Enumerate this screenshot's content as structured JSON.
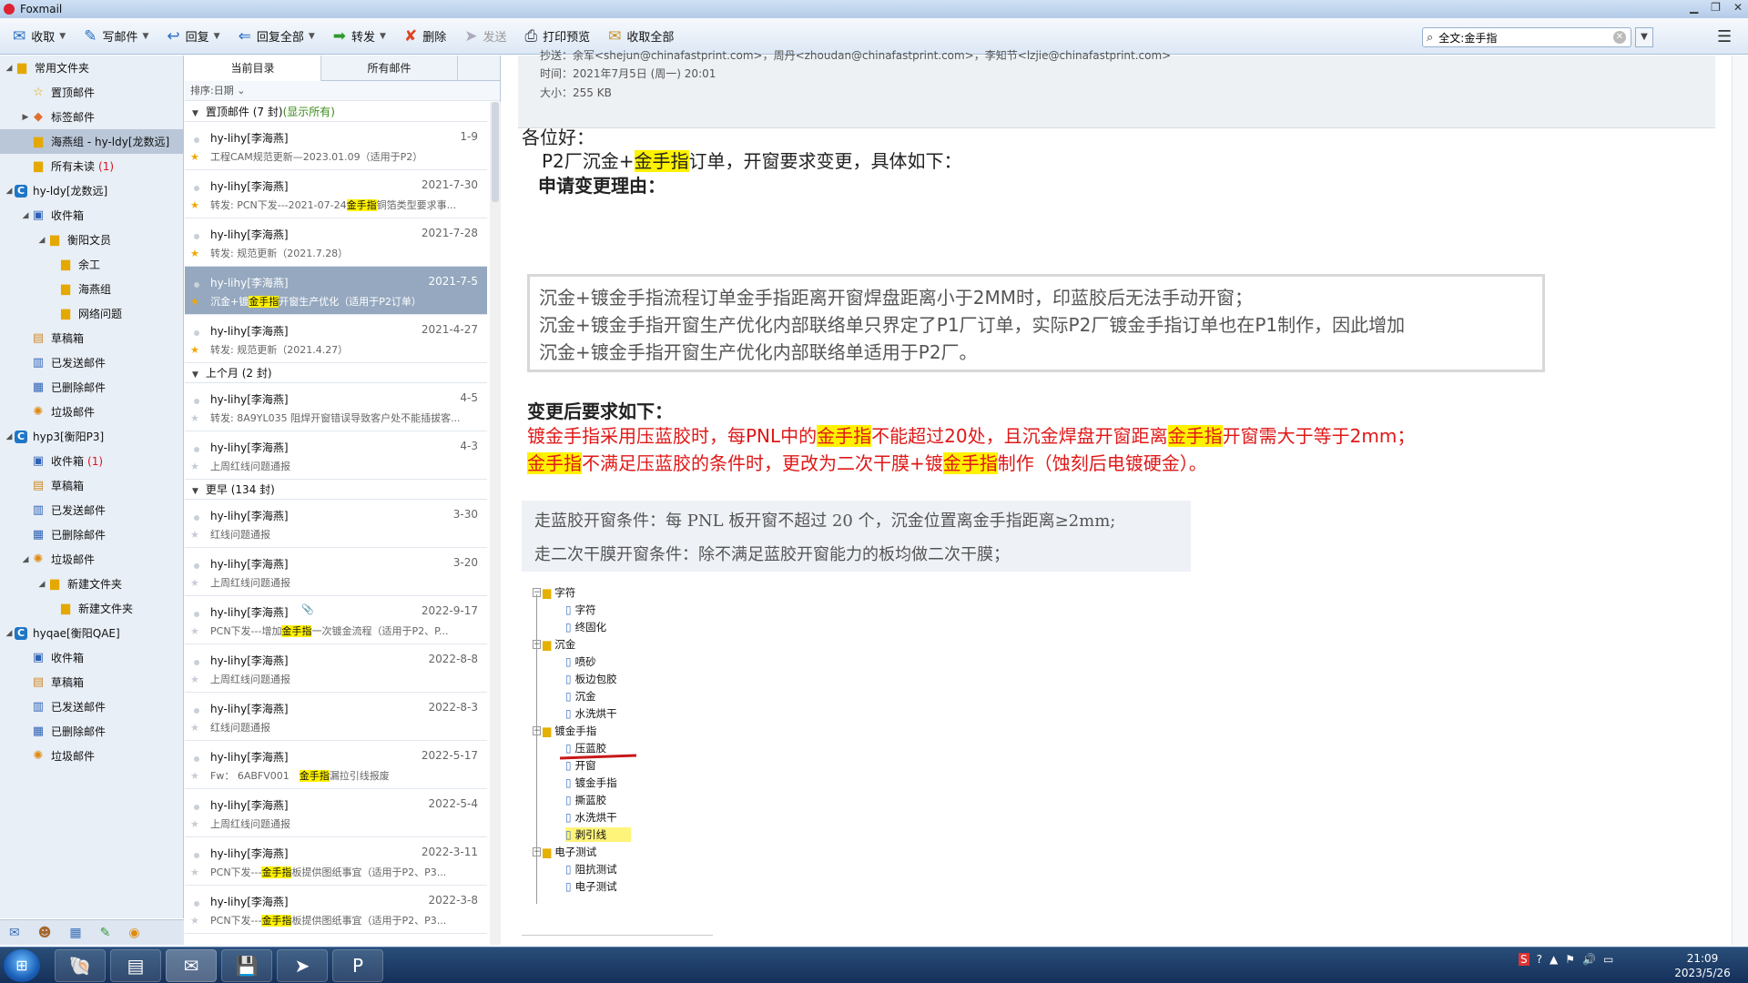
{
  "window": {
    "title": "Foxmail"
  },
  "toolbar": {
    "receive": "收取",
    "compose": "写邮件",
    "reply": "回复",
    "reply_all": "回复全部",
    "forward": "转发",
    "delete": "删除",
    "send": "发送",
    "print_preview": "打印预览",
    "receive_all": "收取全部"
  },
  "search": {
    "value": "全文:金手指"
  },
  "folders": {
    "common": "常用文件夹",
    "pinned": "置顶邮件",
    "tagged": "标签邮件",
    "haiyan": "海燕组 - hy-ldy[龙数远]",
    "unread": "所有未读",
    "unread_count": "(1)",
    "acct1": "hy-ldy[龙数远]",
    "inbox": "收件箱",
    "hengyang": "衡阳文员",
    "yu": "余工",
    "haiyan_group": "海燕组",
    "network": "网络问题",
    "drafts": "草稿箱",
    "sent": "已发送邮件",
    "deleted": "已删除邮件",
    "junk": "垃圾邮件",
    "acct2": "hyp3[衡阳P3]",
    "inbox_count": "(1)",
    "new_folder": "新建文件夹",
    "acct3": "hyqae[衡阳QAE]"
  },
  "maillist": {
    "tab_current": "当前目录",
    "tab_all": "所有邮件",
    "sort": "排序:日期",
    "group_pinned": "置顶邮件 (7 封)",
    "group_pinned_show": "(显示所有)",
    "group_lastmonth": "上个月 (2 封)",
    "group_earlier": "更早 (134 封)",
    "pinned": [
      {
        "from": "hy-lihy[李海燕]",
        "date": "1-9",
        "pre": "工程CAM规范更新—2023.01.09（适用于P2）",
        "hl": "",
        "post": ""
      },
      {
        "from": "hy-lihy[李海燕]",
        "date": "2021-7-30",
        "pre": "转发: PCN下发---2021-07-24",
        "hl": "金手指",
        "post": "铜箔类型要求事..."
      },
      {
        "from": "hy-lihy[李海燕]",
        "date": "2021-7-28",
        "pre": "转发: 规范更新（2021.7.28）",
        "hl": "",
        "post": ""
      },
      {
        "from": "hy-lihy[李海燕]",
        "date": "2021-7-5",
        "pre": "沉金+镀",
        "hl": "金手指",
        "post": "开窗生产优化（适用于P2订单）"
      },
      {
        "from": "hy-lihy[李海燕]",
        "date": "2021-4-27",
        "pre": "转发: 规范更新（2021.4.27）",
        "hl": "",
        "post": ""
      }
    ],
    "lastmonth": [
      {
        "from": "hy-lihy[李海燕]",
        "date": "4-5",
        "pre": "转发: 8A9YL035 阻焊开窗错误导致客户处不能插拔客...",
        "hl": "",
        "post": ""
      },
      {
        "from": "hy-lihy[李海燕]",
        "date": "4-3",
        "pre": "上周红线问题通报",
        "hl": "",
        "post": ""
      }
    ],
    "earlier": [
      {
        "from": "hy-lihy[李海燕]",
        "date": "3-30",
        "pre": "红线问题通报",
        "hl": "",
        "post": ""
      },
      {
        "from": "hy-lihy[李海燕]",
        "date": "3-20",
        "pre": "上周红线问题通报",
        "hl": "",
        "post": ""
      },
      {
        "from": "hy-lihy[李海燕]",
        "date": "2022-9-17",
        "pre": "PCN下发---增加",
        "hl": "金手指",
        "post": "一次镀金流程（适用于P2、P..."
      },
      {
        "from": "hy-lihy[李海燕]",
        "date": "2022-8-8",
        "pre": "上周红线问题通报",
        "hl": "",
        "post": ""
      },
      {
        "from": "hy-lihy[李海燕]",
        "date": "2022-8-3",
        "pre": "红线问题通报",
        "hl": "",
        "post": ""
      },
      {
        "from": "hy-lihy[李海燕]",
        "date": "2022-5-17",
        "pre": "Fw： 6ABFV001　",
        "hl": "金手指",
        "post": "漏拉引线报废"
      },
      {
        "from": "hy-lihy[李海燕]",
        "date": "2022-5-4",
        "pre": "上周红线问题通报",
        "hl": "",
        "post": ""
      },
      {
        "from": "hy-lihy[李海燕]",
        "date": "2022-3-11",
        "pre": "PCN下发---",
        "hl": "金手指",
        "post": "板提供图纸事宜（适用于P2、P3..."
      },
      {
        "from": "hy-lihy[李海燕]",
        "date": "2022-3-8",
        "pre": "PCN下发---",
        "hl": "金手指",
        "post": "板提供图纸事宜（适用于P2、P3..."
      }
    ]
  },
  "email": {
    "cc": "抄送：余军<shejun@chinafastprint.com>，周丹<zhoudan@chinafastprint.com>，李知节<lzjie@chinafastprint.com>",
    "time": "时间：2021年7月5日 (周一) 20:01",
    "size": "大小：255 KB",
    "greeting": "各位好：",
    "intro_a": "P2厂沉金+",
    "kw": "金手指",
    "intro_b": "订单，开窗要求变更，具体如下：",
    "reason_title": "申请变更理由：",
    "reason_lines": [
      "沉金+镀金手指流程订单金手指距离开窗焊盘距离小于2MM时，印蓝胶后无法手动开窗；",
      "沉金+镀金手指开窗生产优化内部联络单只界定了P1厂订单，实际P2厂镀金手指订单也在P1制作，因此增加",
      "沉金+镀金手指开窗生产优化内部联络单适用于P2厂。"
    ],
    "after_title": "变更后要求如下：",
    "r1a": "镀金手指采用压蓝胶时，每PNL中的",
    "r1b": "不能超过20处，且沉金焊盘开窗距离",
    "r1c": "开窗需大于等于2mm；",
    "r2a": "不满足压蓝胶的条件时，更改为二次干膜+镀",
    "r2b": "制作（蚀刻后电镀硬金）。",
    "scan1": "走蓝胶开窗条件：每 PNL 板开窗不超过 20 个，沉金位置离金手指距离≥2mm;",
    "scan2": "走二次干膜开窗条件：除不满足蓝胶开窗能力的板均做二次干膜；",
    "tree": {
      "f1": "字符",
      "f1a": "字符",
      "f1b": "终固化",
      "f2": "沉金",
      "f2a": "喷砂",
      "f2b": "板边包胶",
      "f2c": "沉金",
      "f2d": "水洗烘干",
      "f3": "镀金手指",
      "f3a": "压蓝胶",
      "f3b": "开窗",
      "f3c": "镀金手指",
      "f3d": "撕蓝胶",
      "f3e": "水洗烘干",
      "f3f": "剥引线",
      "f4": "电子测试",
      "f4a": "阻抗测试",
      "f4b": "电子测试"
    }
  },
  "taskbar": {
    "time": "21:09",
    "date": "2023/5/26"
  },
  "colors": {
    "highlight": "#fff200",
    "red_text": "#e01818",
    "selected_row": "#95a8bf"
  }
}
